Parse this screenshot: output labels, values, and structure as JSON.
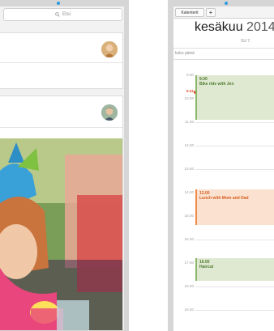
{
  "left_app": {
    "search": {
      "placeholder": "Etsi"
    }
  },
  "calendar": {
    "toolbar": {
      "calendars_label": "Kalenterit",
      "add_label": "+"
    },
    "month": "kesäkuu",
    "year": "2014",
    "day_label": "SU 7.",
    "all_day_label": "koko päivä",
    "hours": [
      "9.00",
      "10.00",
      "11.00",
      "12.00",
      "13.00",
      "14.00",
      "15.00",
      "16.00",
      "17.00",
      "18.00",
      "19.00"
    ],
    "current_time": "9.41",
    "events": [
      {
        "time": "9.00",
        "title": "Bike ride with Jen",
        "color": "#8cb66a"
      },
      {
        "time": "13.00",
        "title": "Lunch with Mom and Dad",
        "color": "#f08a48"
      },
      {
        "time": "16.00",
        "title": "Haircut",
        "color": "#8cb66a"
      }
    ]
  },
  "colors": {
    "accent_blue": "#2f9be0",
    "now_red": "#e04a2a"
  }
}
